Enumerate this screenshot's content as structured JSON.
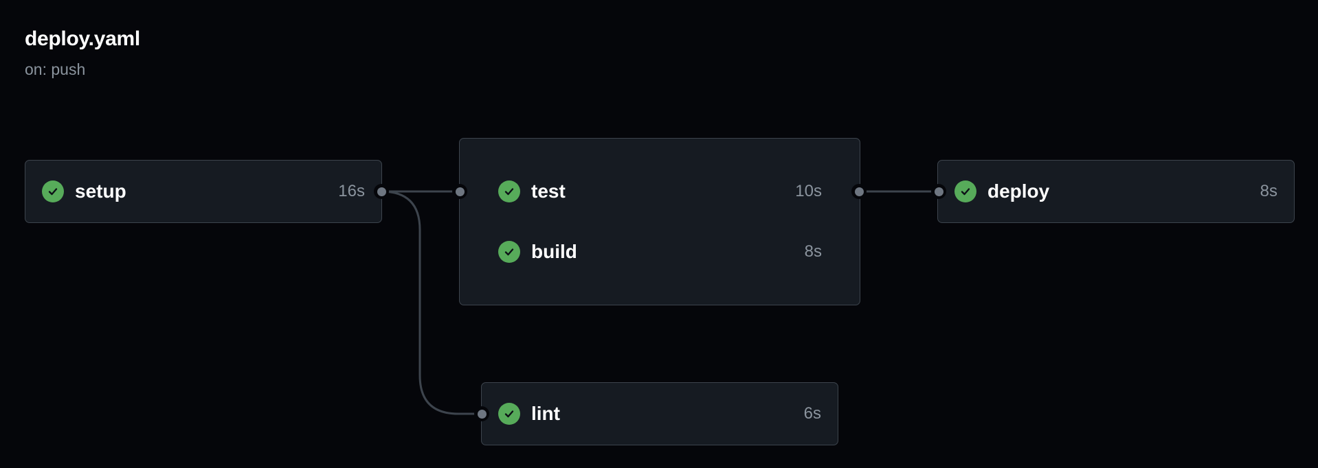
{
  "workflow": {
    "title": "deploy.yaml",
    "trigger": "on: push"
  },
  "status_color": "#57ab5a",
  "jobs": {
    "setup": {
      "name": "setup",
      "duration": "16s",
      "status": "success",
      "icon": "check-circle-icon"
    },
    "test": {
      "name": "test",
      "duration": "10s",
      "status": "success",
      "icon": "check-circle-icon"
    },
    "build": {
      "name": "build",
      "duration": "8s",
      "status": "success",
      "icon": "check-circle-icon"
    },
    "deploy": {
      "name": "deploy",
      "duration": "8s",
      "status": "success",
      "icon": "check-circle-icon"
    },
    "lint": {
      "name": "lint",
      "duration": "6s",
      "status": "success",
      "icon": "check-circle-icon"
    }
  },
  "dependencies": [
    {
      "from": "setup",
      "to": "test-build group"
    },
    {
      "from": "setup",
      "to": "lint"
    },
    {
      "from": "test-build group",
      "to": "deploy"
    }
  ]
}
